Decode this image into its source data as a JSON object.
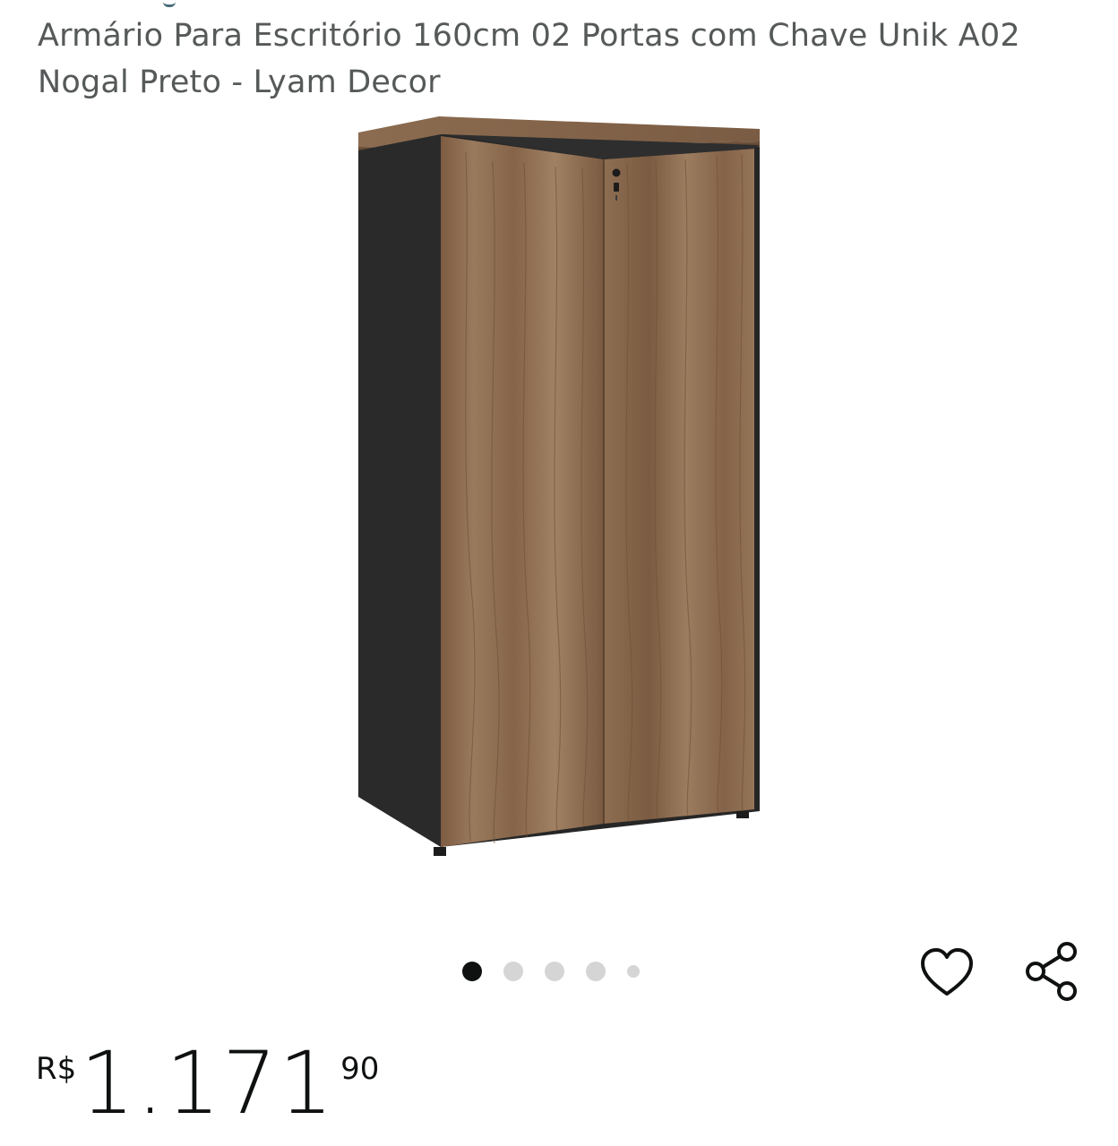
{
  "product": {
    "title": "Armário Para Escritório 160cm 02 Portas com Chave Unik A02 Nogal Preto - Lyam Decor",
    "image_icon": "wooden-two-door-cabinet-image"
  },
  "carousel": {
    "dot_count": 5,
    "active_index": 0
  },
  "actions": {
    "favorite_icon": "heart-icon",
    "share_icon": "share-icon"
  },
  "price": {
    "currency": "R$",
    "whole": "1.171",
    "cents": "90"
  },
  "colors": {
    "wood": "#8a6a4e",
    "cabinet_body": "#2b2b2b",
    "active_dot": "#0f1111",
    "inactive_dot": "#d5d5d5"
  }
}
